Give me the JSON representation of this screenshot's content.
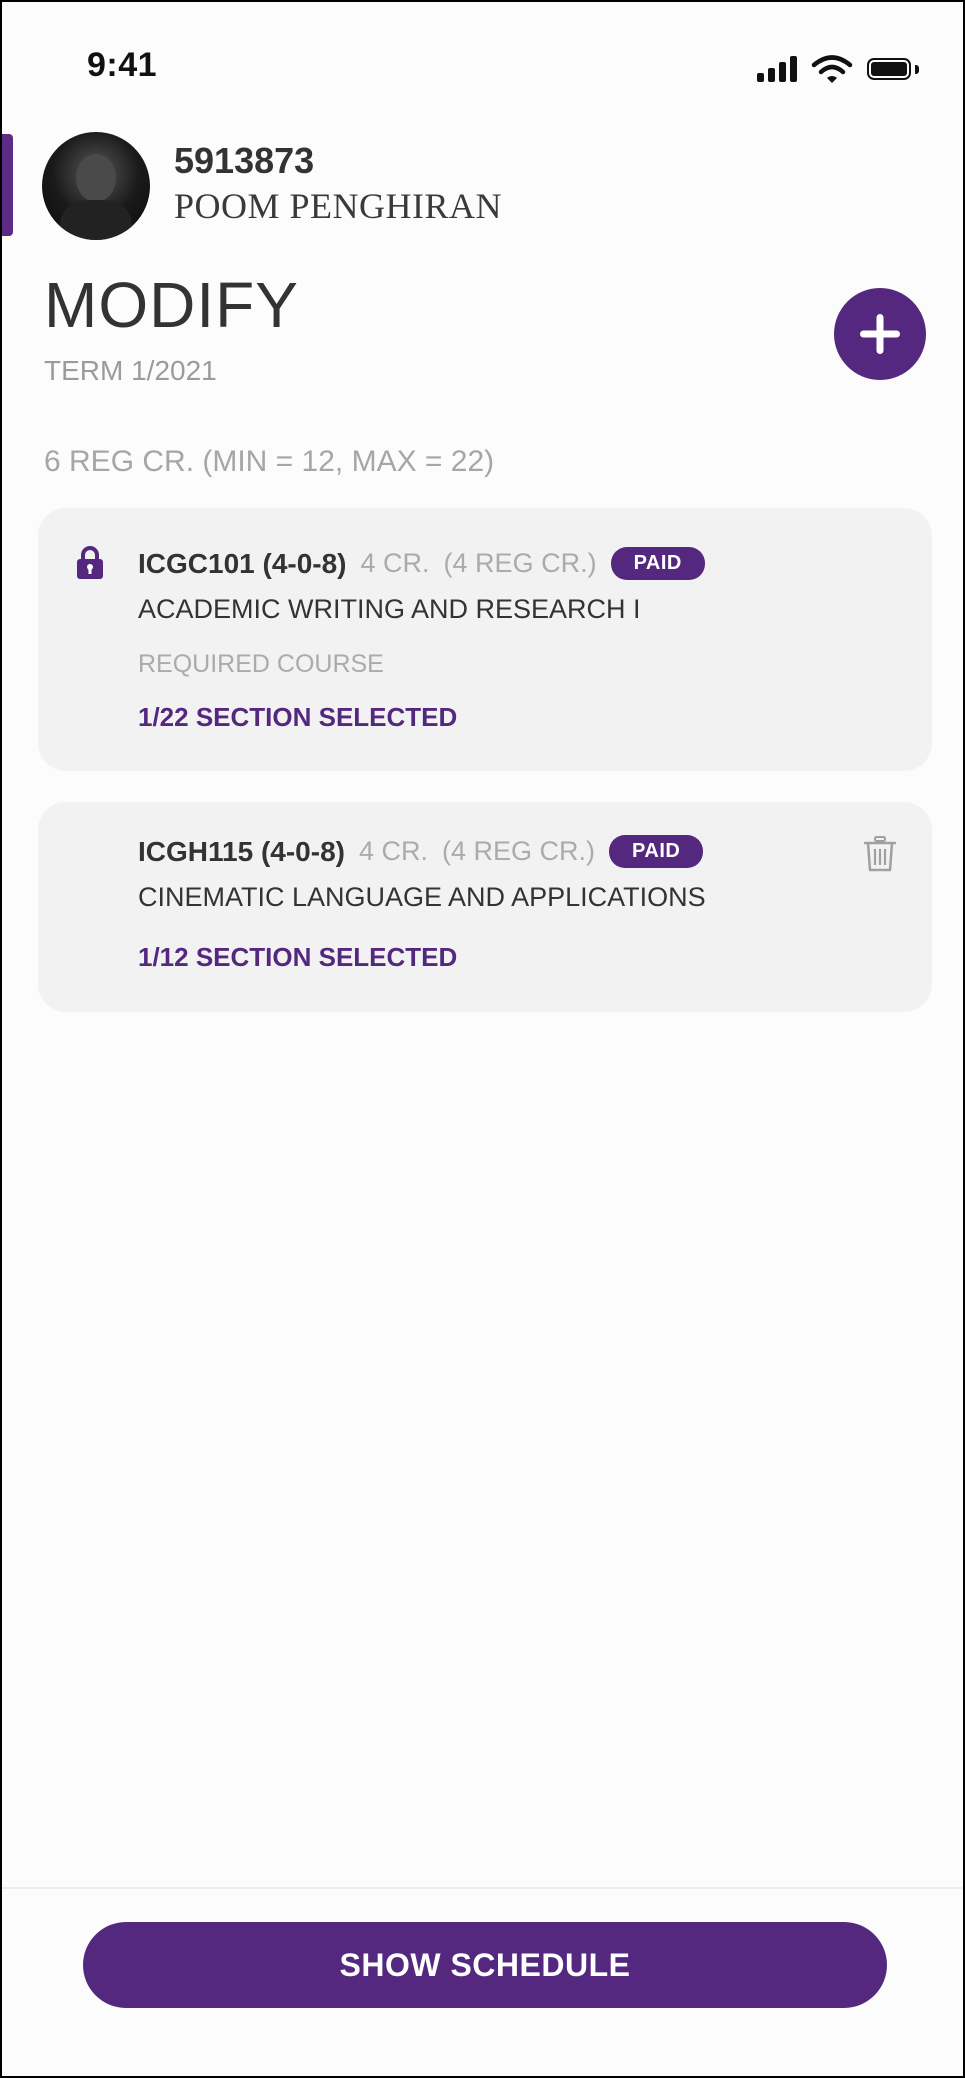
{
  "status_bar": {
    "time": "9:41"
  },
  "profile": {
    "id": "5913873",
    "name": "POOM PENGHIRAN"
  },
  "page": {
    "title": "MODIFY",
    "term": "TERM 1/2021",
    "credits_summary": "6 REG CR. (MIN = 12, MAX = 22)"
  },
  "courses": [
    {
      "code": "ICGC101 (4-0-8)",
      "credits": "4 CR.",
      "reg_credits": "(4 REG CR.)",
      "badge": "PAID",
      "title": "ACADEMIC WRITING AND RESEARCH I",
      "type": "REQUIRED COURSE",
      "sections": "1/22 SECTION SELECTED",
      "icon": "lock-icon"
    },
    {
      "code": "ICGH115 (4-0-8)",
      "credits": "4 CR.",
      "reg_credits": "(4 REG CR.)",
      "badge": "PAID",
      "title": "CINEMATIC LANGUAGE AND APPLICATIONS",
      "sections": "1/12 SECTION SELECTED",
      "icon": "trash-icon"
    }
  ],
  "actions": {
    "show_schedule": "SHOW SCHEDULE",
    "add_icon": "plus-icon"
  },
  "colors": {
    "accent": "#55287f",
    "card_bg": "#f2f2f2",
    "muted": "#a6a6a6"
  }
}
